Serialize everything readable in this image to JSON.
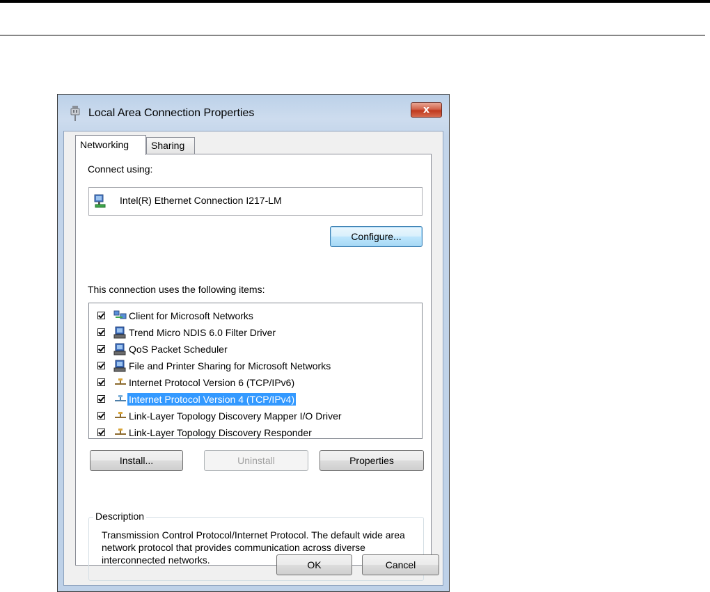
{
  "dialog": {
    "title": "Local Area Connection Properties",
    "close_label": "x"
  },
  "tabs": [
    {
      "label": "Networking",
      "active": true
    },
    {
      "label": "Sharing",
      "active": false
    }
  ],
  "connect_using": {
    "label": "Connect using:",
    "adapter_name": "Intel(R) Ethernet Connection I217-LM",
    "configure_label": "Configure..."
  },
  "items_section": {
    "label": "This connection uses the following items:",
    "items": [
      {
        "label": "Client for Microsoft Networks",
        "checked": true,
        "icon": "network-client-icon"
      },
      {
        "label": "Trend Micro NDIS 6.0 Filter Driver",
        "checked": true,
        "icon": "network-service-icon"
      },
      {
        "label": "QoS Packet Scheduler",
        "checked": true,
        "icon": "network-service-icon"
      },
      {
        "label": "File and Printer Sharing for Microsoft Networks",
        "checked": true,
        "icon": "network-service-icon"
      },
      {
        "label": "Internet Protocol Version 6 (TCP/IPv6)",
        "checked": true,
        "icon": "protocol-icon"
      },
      {
        "label": "Internet Protocol Version 4 (TCP/IPv4)",
        "checked": true,
        "icon": "protocol-icon",
        "selected": true
      },
      {
        "label": "Link-Layer Topology Discovery Mapper I/O Driver",
        "checked": true,
        "icon": "protocol-icon"
      },
      {
        "label": "Link-Layer Topology Discovery Responder",
        "checked": true,
        "icon": "protocol-icon"
      }
    ]
  },
  "actions": {
    "install": "Install...",
    "uninstall": "Uninstall",
    "properties": "Properties"
  },
  "description": {
    "legend": "Description",
    "text": "Transmission Control Protocol/Internet Protocol. The default wide area network protocol that provides communication across diverse interconnected networks."
  },
  "footer": {
    "ok": "OK",
    "cancel": "Cancel"
  },
  "colors": {
    "selection": "#3399ff",
    "titlebar": "#bcd1e9",
    "close": "#c0391e"
  }
}
